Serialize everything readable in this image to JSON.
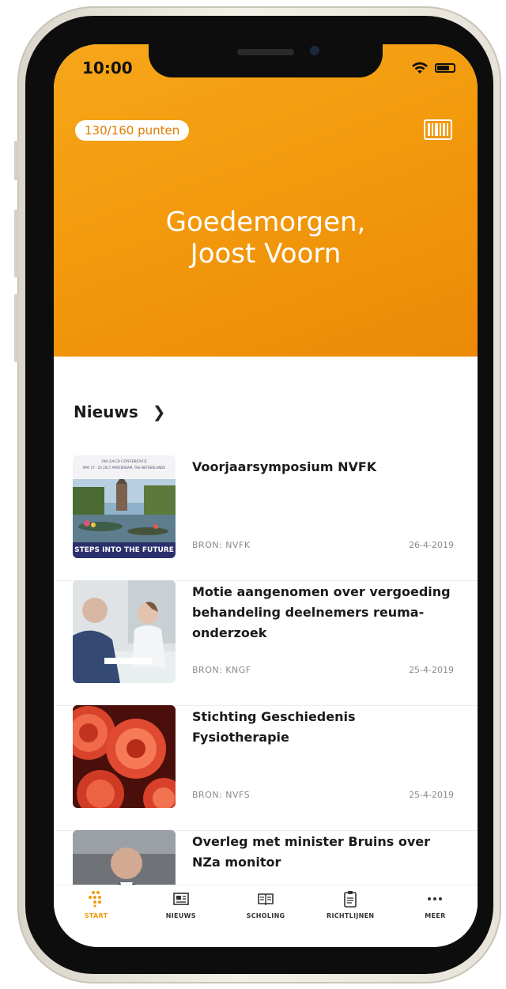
{
  "status": {
    "time": "10:00"
  },
  "header": {
    "points": "130/160 punten",
    "greeting_line1": "Goedemorgen,",
    "greeting_line2": "Joost Voorn",
    "accent": "#f39a0d"
  },
  "news": {
    "heading": "Nieuws",
    "items": [
      {
        "title": "Voorjaarsymposium NVFK",
        "source": "BRON: NVFK",
        "date": "26-4-2019",
        "thumb_caption_top": "29th EACD CONFERENCE",
        "thumb_caption_sub": "MAY 17 - 20 2017 AMSTERDAM, THE NETHERLANDS",
        "thumb_caption_bottom": "STEPS INTO THE FUTURE"
      },
      {
        "title": "Motie aangenomen over vergoeding behandeling deelnemers reuma-onderzoek",
        "source": "BRON: KNGF",
        "date": "25-4-2019"
      },
      {
        "title": "Stichting Geschiedenis Fysiotherapie",
        "source": "BRON: NVFS",
        "date": "25-4-2019"
      },
      {
        "title": "Overleg met minister Bruins over NZa monitor",
        "source": "",
        "date": ""
      }
    ]
  },
  "tabs": [
    {
      "label": "START",
      "icon": "dots-grid-icon",
      "active": true
    },
    {
      "label": "NIEUWS",
      "icon": "newspaper-icon"
    },
    {
      "label": "SCHOLING",
      "icon": "book-icon"
    },
    {
      "label": "RICHTLIJNEN",
      "icon": "clipboard-icon"
    },
    {
      "label": "MEER",
      "icon": "more-icon"
    }
  ]
}
